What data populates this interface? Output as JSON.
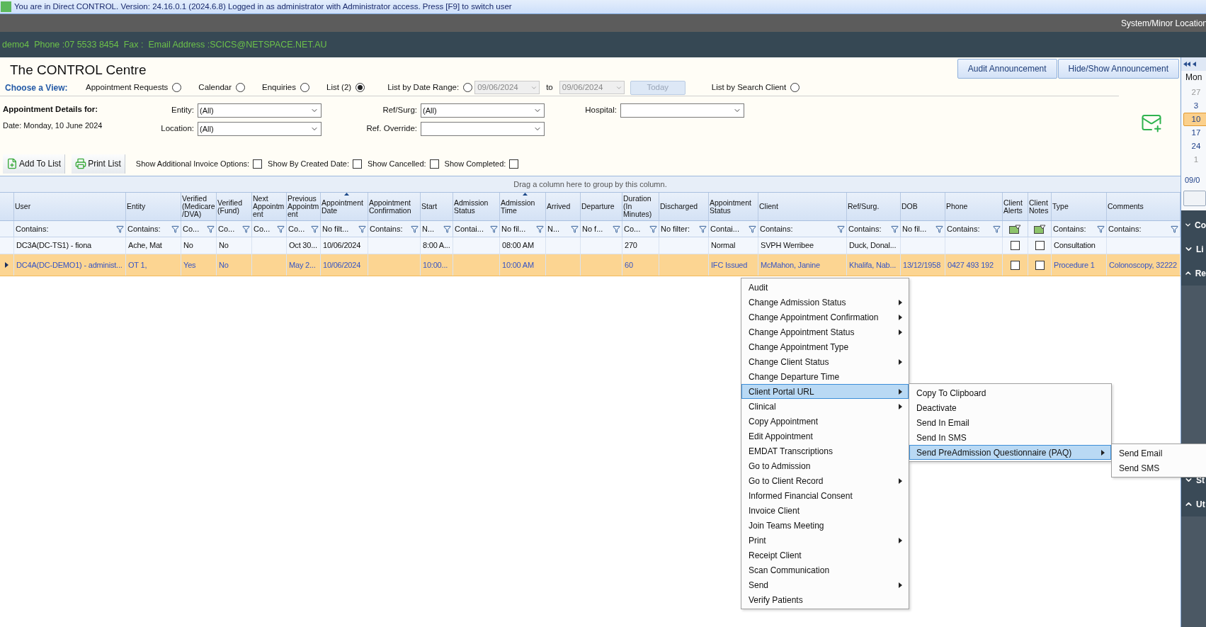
{
  "title_bar": {
    "text": "You are in Direct CONTROL. Version: 24.16.0.1 (2024.6.8) Logged in as administrator with Administrator access. Press [F9] to switch user"
  },
  "location_bar": {
    "text": "System/Minor Location"
  },
  "info_bar": {
    "text": "demo4  Phone :07 5533 8454  Fax :  Email Address :SCICS@NETSPACE.NET.AU"
  },
  "page_title": "The CONTROL Centre",
  "announcement_buttons": [
    {
      "label": "Audit Announcement"
    },
    {
      "label": "Hide/Show Announcement"
    }
  ],
  "view": {
    "label": "Choose a View:",
    "items": [
      {
        "kind": "radio",
        "label": "Appointment Requests",
        "selected": false
      },
      {
        "kind": "radio",
        "label": "Calendar",
        "selected": false
      },
      {
        "kind": "radio",
        "label": "Enquiries",
        "selected": false
      },
      {
        "kind": "radio",
        "label": "List (2)",
        "selected": true
      },
      {
        "kind": "radio",
        "label": "List by Date Range:",
        "selected": false
      },
      {
        "kind": "date",
        "value": "09/06/2024",
        "disabled": true
      },
      {
        "kind": "text",
        "label": "to"
      },
      {
        "kind": "date",
        "value": "09/06/2024",
        "disabled": true
      },
      {
        "kind": "button",
        "label": "Today",
        "disabled": true
      },
      {
        "kind": "radio",
        "label": "List by Search Client",
        "selected": false
      }
    ]
  },
  "details": {
    "heading": "Appointment Details for:",
    "date": "Date: Monday, 10 June 2024"
  },
  "filter_groups": [
    {
      "fields": [
        {
          "label": "Entity:",
          "value": "(All)"
        },
        {
          "label": "Location:",
          "value": "(All)"
        }
      ]
    },
    {
      "fields": [
        {
          "label": "Ref/Surg:",
          "value": "(All)"
        },
        {
          "label": "Ref. Override:"
        }
      ]
    },
    {
      "fields": [
        {
          "label": "Hospital:"
        }
      ]
    }
  ],
  "toolbar": {
    "buttons": [
      {
        "kind": "add",
        "label": "Add To List"
      },
      {
        "kind": "print",
        "label": "Print List"
      }
    ],
    "options": [
      {
        "label": "Show Additional Invoice Options:",
        "checked": false
      },
      {
        "label": "Show By Created Date:",
        "checked": false
      },
      {
        "label": "Show Cancelled:",
        "checked": false
      },
      {
        "label": "Show Completed:",
        "checked": false
      }
    ]
  },
  "group_panel": {
    "text": "Drag a column here to group by this column."
  },
  "table": {
    "columns": [
      {
        "label": "User",
        "kind": "text",
        "sorted": false
      },
      {
        "label": "Entity",
        "kind": "text",
        "sorted": false
      },
      {
        "label": "Verified (Medicare/DVA)",
        "kind": "text",
        "sorted": false
      },
      {
        "label": "Verified (Fund)",
        "kind": "text",
        "sorted": false
      },
      {
        "label": "Next Appointment",
        "kind": "text",
        "sorted": false
      },
      {
        "label": "Previous Appointment",
        "kind": "text",
        "sorted": false
      },
      {
        "label": "Appointment Date",
        "kind": "text",
        "sorted": true
      },
      {
        "label": "Appointment Confirmation",
        "kind": "text",
        "sorted": false
      },
      {
        "label": "Start",
        "kind": "text",
        "sorted": false
      },
      {
        "label": "Admission Status",
        "kind": "text",
        "sorted": false
      },
      {
        "label": "Admission Time",
        "kind": "text",
        "sorted": true
      },
      {
        "label": "Arrived",
        "kind": "text",
        "sorted": false
      },
      {
        "label": "Departure",
        "kind": "text",
        "sorted": false
      },
      {
        "label": "Duration (In Minutes)",
        "kind": "text",
        "sorted": false
      },
      {
        "label": "Discharged",
        "kind": "text",
        "sorted": false
      },
      {
        "label": "Appointment Status",
        "kind": "text",
        "sorted": false
      },
      {
        "label": "Client",
        "kind": "text",
        "sorted": false
      },
      {
        "label": "Ref/Surg.",
        "kind": "text",
        "sorted": false
      },
      {
        "label": "DOB",
        "kind": "text",
        "sorted": false
      },
      {
        "label": "Phone",
        "kind": "text",
        "sorted": false
      },
      {
        "label": "Client Alerts",
        "kind": "checkbox",
        "sorted": false
      },
      {
        "label": "Client Notes",
        "kind": "checkbox",
        "sorted": false
      },
      {
        "label": "Type",
        "kind": "text",
        "sorted": false
      },
      {
        "label": "Comments",
        "kind": "text",
        "sorted": false
      }
    ],
    "filters": [
      {
        "kind": "text",
        "text": "Contains:"
      },
      {
        "kind": "text",
        "text": "Contains:"
      },
      {
        "kind": "text",
        "text": "Co..."
      },
      {
        "kind": "text",
        "text": "Co..."
      },
      {
        "kind": "text",
        "text": "Co..."
      },
      {
        "kind": "text",
        "text": "Co..."
      },
      {
        "kind": "text",
        "text": "No filt..."
      },
      {
        "kind": "text",
        "text": "Contains:"
      },
      {
        "kind": "text",
        "text": "N..."
      },
      {
        "kind": "text",
        "text": "Contai..."
      },
      {
        "kind": "text",
        "text": "No fil..."
      },
      {
        "kind": "text",
        "text": "N..."
      },
      {
        "kind": "text",
        "text": "No f..."
      },
      {
        "kind": "text",
        "text": "Co..."
      },
      {
        "kind": "text",
        "text": "No filter:"
      },
      {
        "kind": "text",
        "text": "Contai..."
      },
      {
        "kind": "text",
        "text": "Contains:"
      },
      {
        "kind": "text",
        "text": "Contains:"
      },
      {
        "kind": "text",
        "text": "No fil..."
      },
      {
        "kind": "text",
        "text": "Contains:"
      },
      {
        "kind": "icon"
      },
      {
        "kind": "icon"
      },
      {
        "kind": "text",
        "text": "Contains:"
      },
      {
        "kind": "text",
        "text": "Contains:"
      }
    ],
    "rows": [
      {
        "selected": false,
        "cells": [
          "DC3A(DC-TS1) - fiona",
          "Ache, Mat",
          "No",
          "No",
          null,
          "Oct 30...",
          "10/06/2024",
          null,
          "8:00 A...",
          null,
          "08:00 AM",
          null,
          null,
          "270",
          null,
          "Normal",
          "SVPH Werribee",
          "Duck, Donal...",
          null,
          null,
          {
            "checked": false
          },
          {
            "checked": false
          },
          "Consultation",
          null
        ]
      },
      {
        "selected": true,
        "cells": [
          "DC4A(DC-DEMO1) - administ...",
          "OT 1,",
          "Yes",
          "No",
          null,
          "May 2...",
          "10/06/2024",
          null,
          "10:00...",
          null,
          "10:00 AM",
          null,
          null,
          "60",
          null,
          "IFC Issued",
          "McMahon, Janine",
          "Khalifa, Nab...",
          "13/12/1958",
          "0427 493 192",
          {
            "checked": false
          },
          {
            "checked": false
          },
          "Procedure 1",
          "Colonoscopy, 32222"
        ]
      }
    ]
  },
  "context_menu": {
    "items": [
      {
        "label": "Audit",
        "has_submenu": false,
        "expanded": false
      },
      {
        "label": "Change Admission Status",
        "has_submenu": true,
        "expanded": false
      },
      {
        "label": "Change Appointment Confirmation",
        "has_submenu": true,
        "expanded": false
      },
      {
        "label": "Change Appointment Status",
        "has_submenu": true,
        "expanded": false
      },
      {
        "label": "Change Appointment Type",
        "has_submenu": false,
        "expanded": false
      },
      {
        "label": "Change Client Status",
        "has_submenu": true,
        "expanded": false
      },
      {
        "label": "Change Departure Time",
        "has_submenu": false,
        "expanded": false
      },
      {
        "label": "Client Portal URL",
        "has_submenu": true,
        "expanded": true,
        "children": [
          {
            "label": "Copy To Clipboard",
            "has_submenu": false,
            "expanded": false
          },
          {
            "label": "Deactivate",
            "has_submenu": false,
            "expanded": false
          },
          {
            "label": "Send In Email",
            "has_submenu": false,
            "expanded": false
          },
          {
            "label": "Send In SMS",
            "has_submenu": false,
            "expanded": false
          },
          {
            "label": "Send PreAdmission Questionnaire (PAQ)",
            "has_submenu": true,
            "expanded": true,
            "children": [
              {
                "label": "Send Email",
                "has_submenu": false,
                "expanded": false
              },
              {
                "label": "Send SMS",
                "has_submenu": false,
                "expanded": false
              }
            ]
          }
        ]
      },
      {
        "label": "Clinical",
        "has_submenu": true,
        "expanded": false
      },
      {
        "label": "Copy Appointment",
        "has_submenu": false,
        "expanded": false
      },
      {
        "label": "Edit Appointment",
        "has_submenu": false,
        "expanded": false
      },
      {
        "label": "EMDAT Transcriptions",
        "has_submenu": false,
        "expanded": false
      },
      {
        "label": "Go to Admission",
        "has_submenu": false,
        "expanded": false
      },
      {
        "label": "Go to Client Record",
        "has_submenu": true,
        "expanded": false
      },
      {
        "label": "Informed Financial Consent",
        "has_submenu": false,
        "expanded": false
      },
      {
        "label": "Invoice Client",
        "has_submenu": false,
        "expanded": false
      },
      {
        "label": "Join Teams Meeting",
        "has_submenu": false,
        "expanded": false
      },
      {
        "label": "Print",
        "has_submenu": true,
        "expanded": false
      },
      {
        "label": "Receipt Client",
        "has_submenu": false,
        "expanded": false
      },
      {
        "label": "Scan Communication",
        "has_submenu": false,
        "expanded": false
      },
      {
        "label": "Send",
        "has_submenu": true,
        "expanded": false
      },
      {
        "label": "Verify Patients",
        "has_submenu": false,
        "expanded": false
      }
    ]
  },
  "calendar": {
    "weekday": "Mon",
    "days": [
      {
        "label": "27",
        "muted": true,
        "selected": false
      },
      {
        "label": "3",
        "muted": false,
        "selected": false
      },
      {
        "label": "10",
        "muted": false,
        "selected": true
      },
      {
        "label": "17",
        "muted": false,
        "selected": false
      },
      {
        "label": "24",
        "muted": false,
        "selected": false
      },
      {
        "label": "1",
        "muted": true,
        "selected": false
      }
    ],
    "footer": "09/0"
  },
  "sidebar": {
    "sections": [
      {
        "label": "Co",
        "expanded": false
      },
      {
        "label": "Li",
        "expanded": false
      },
      {
        "label": "Re",
        "expanded": true
      },
      {
        "label": "St",
        "expanded": false
      },
      {
        "label": "Ut",
        "expanded": true
      }
    ]
  }
}
